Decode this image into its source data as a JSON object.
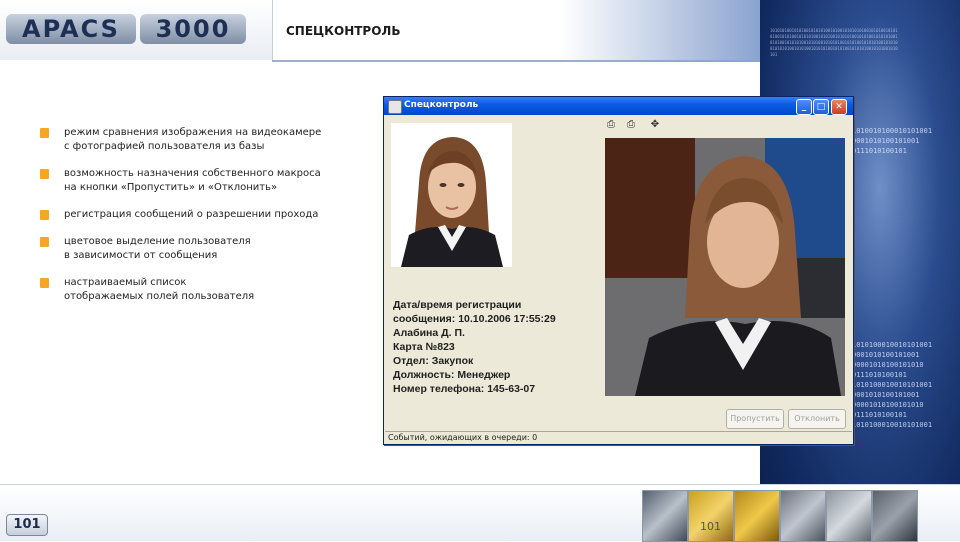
{
  "header": {
    "logo_part1": "APACS",
    "logo_part2": "3000",
    "slide_title": "СПЕЦКОНТРОЛЬ"
  },
  "bullets": [
    {
      "line1": "режим сравнения изображения на видеокамере",
      "line2": "с фотографией пользователя из базы"
    },
    {
      "line1": "возможность назначения собственного макроса",
      "line2": "на кнопки «Пропустить» и «Отклонить»"
    },
    {
      "line1": "регистрация сообщений о разрешении прохода",
      "line2": ""
    },
    {
      "line1": "цветовое  выделение пользователя",
      "line2": "в зависимости от сообщения"
    },
    {
      "line1": "настраиваемый список",
      "line2": "отображаемых полей пользователя"
    }
  ],
  "window": {
    "title": "Спецконтроль",
    "minimize_glyph": "_",
    "maximize_glyph": "□",
    "close_glyph": "✕",
    "info_lines": [
      "Дата/время регистрации",
      "сообщения: 10.10.2006 17:55:29",
      "Алабина Д. П.",
      "Карта №823",
      "Отдел: Закупок",
      "Должность: Менеджер",
      "Номер телефона: 145-63-07"
    ],
    "allow_button": "Пропустить",
    "reject_button": "Отклонить",
    "status_text": "Событий, ожидающих в очереди: 0",
    "tool_icons": [
      "print-icon",
      "print-preview-icon",
      "move-icon"
    ]
  },
  "binary_lines": [
    "1010010100010101001",
    "0001010100101001",
    "00001010000101010",
    "0111010100101",
    "1010100010010101001",
    "0001010100101001",
    "00001010100101010",
    "0111010100101"
  ],
  "footer": {
    "page_badge": "101",
    "page_number": "101"
  },
  "colors": {
    "accent_bullet": "#f5a623",
    "titlebar_blue": "#0a5ce6",
    "bg_dark_blue": "#112a60"
  }
}
